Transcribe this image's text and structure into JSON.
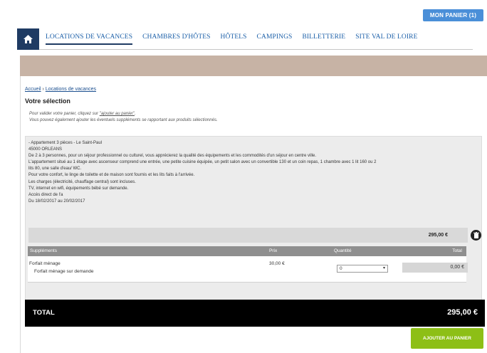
{
  "header": {
    "cart_label": "MON PANIER (1)"
  },
  "nav": {
    "items": [
      "LOCATIONS DE VACANCES",
      "CHAMBRES D'HÔTES",
      "HÔTELS",
      "CAMPINGS",
      "BILLETTERIE",
      "SITE VAL DE LOIRE"
    ]
  },
  "breadcrumb": {
    "home": "Accueil",
    "sep": " › ",
    "current": "Locations de vacances"
  },
  "page_title": "Votre sélection",
  "notice": {
    "line1_prefix": "Pour valider votre panier, cliquez sur ",
    "line1_link": "\"ajouter au panier\"",
    "line1_suffix": ".",
    "line2": "Vous pouvez également ajouter les éventuels suppléments se rapportant aux produits sélectionnés."
  },
  "product": {
    "lines": [
      "- Appartement 3 pièces - Le Saint-Paul",
      "45000 ORLEANS",
      "De 2 à 3 personnes, pour un séjour professionnel ou culturel, vous apprécierez la qualité des équipements et les commodités d'un séjour en centre ville.",
      "L'appartement situé au 1 étage avec ascenseur comprend une entrée, une petite cuisine équipée, un petit salon avec un convertible 130 et un coin repas, 1 chambre avec 1 lit 160 ou 2",
      "lits 80, une salle d'eau/ WC.",
      "Pour votre confort, le linge de toilette et de maison sont fournis et les lits faits à l'arrivée.",
      "Les charges (électricité, chauffage central) sont incluses.",
      "TV, internet en wifi, équipements bébé sur demande.",
      "Accès direct de l'a",
      "Du 18/02/2017 au 20/02/2017"
    ],
    "price": "295,00 €"
  },
  "supplements": {
    "headers": {
      "name": "Suppléments",
      "price": "Prix",
      "qty": "Quantité",
      "total": "Total"
    },
    "rows": [
      {
        "label": "Forfait ménage",
        "sub": "Forfait ménage sur demande",
        "price": "30,00 €",
        "qty": "0",
        "total": "0,00 €"
      }
    ]
  },
  "total": {
    "label": "TOTAL",
    "value": "295,00 €"
  },
  "add_button": "AJOUTER AU PANIER",
  "colors": {
    "accent_blue": "#4a8fd8",
    "nav_dark": "#1f3b63",
    "band": "#c7b3a5",
    "add_green": "#8dbf16"
  }
}
